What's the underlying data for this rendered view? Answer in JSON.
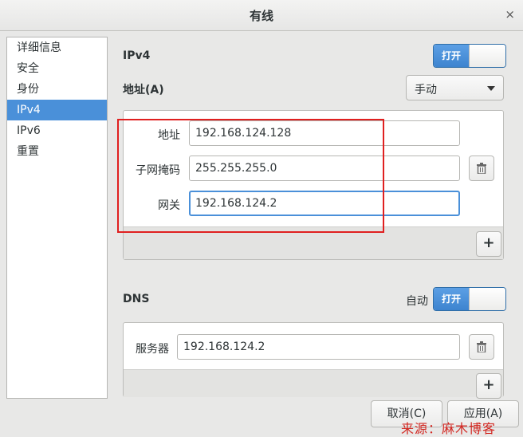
{
  "window": {
    "title": "有线",
    "close_glyph": "×"
  },
  "sidebar": {
    "items": [
      {
        "label": "详细信息"
      },
      {
        "label": "安全"
      },
      {
        "label": "身份"
      },
      {
        "label": "IPv4"
      },
      {
        "label": "IPv6"
      },
      {
        "label": "重置"
      }
    ],
    "selected": "IPv4"
  },
  "ipv4": {
    "section_title": "IPv4",
    "toggle_label": "打开",
    "toggle_state": "on",
    "address_label": "地址(A)",
    "method": "手动",
    "fields": {
      "address_label": "地址",
      "address_value": "192.168.124.128",
      "netmask_label": "子网掩码",
      "netmask_value": "255.255.255.0",
      "gateway_label": "网关",
      "gateway_value": "192.168.124.2"
    },
    "add_glyph": "+"
  },
  "dns": {
    "section_title": "DNS",
    "auto_label": "自动",
    "toggle_label": "打开",
    "toggle_state": "on",
    "server_label": "服务器",
    "server_value": "192.168.124.2",
    "add_glyph": "+"
  },
  "buttons": {
    "cancel": "取消(C)",
    "apply": "应用(A)"
  },
  "watermark": "来源：麻木博客",
  "colors": {
    "accent": "#4a90d9",
    "highlight": "#e02020"
  },
  "icons": {
    "delete": "trash-icon",
    "add": "plus-icon",
    "dropdown": "chevron-down-icon"
  }
}
